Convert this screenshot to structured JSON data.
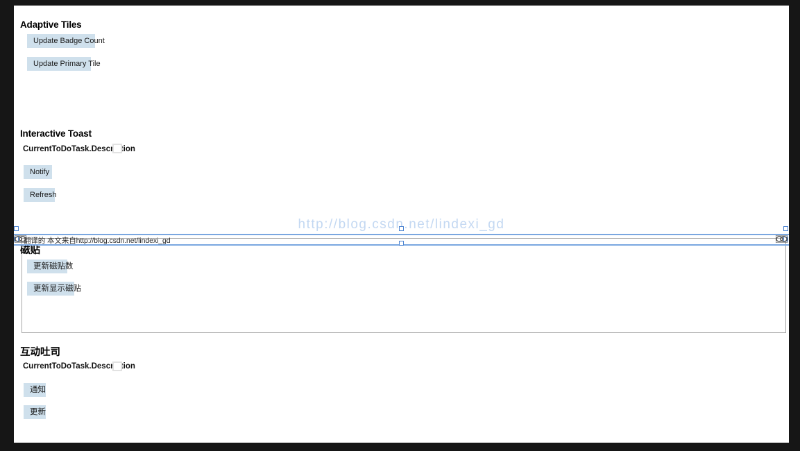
{
  "window": {
    "background": "#161616",
    "page_background": "#ffffff"
  },
  "colors": {
    "button": "#cfe0ec",
    "selection": "#7aa7e0",
    "watermark": "#c3d8f2",
    "box_border": "#a6a6a6"
  },
  "original": {
    "tiles_section": {
      "title": "Adaptive Tiles",
      "buttons": [
        {
          "label": "Update Badge Count"
        },
        {
          "label": "Update Primary Tile"
        }
      ]
    },
    "toast_section": {
      "title": "Interactive Toast",
      "field_label": "CurrentToDoTask.Description",
      "field_value": "",
      "buttons": [
        {
          "label": "Notify"
        },
        {
          "label": "Refresh"
        }
      ]
    }
  },
  "overlay": {
    "translation_note": "翻译的 本文来自http://blog.csdn.net/lindexi_gd",
    "link_icon_left": "link-icon",
    "link_icon_right": "link-icon",
    "watermark": "http://blog.csdn.net/lindexi_gd"
  },
  "translated": {
    "tiles_section": {
      "title": "磁贴",
      "buttons": [
        {
          "label": "更新磁贴数"
        },
        {
          "label": "更新显示磁贴"
        }
      ]
    },
    "toast_section": {
      "title": "互动吐司",
      "field_label": "CurrentToDoTask.Description",
      "field_value": "",
      "buttons": [
        {
          "label": "通知"
        },
        {
          "label": "更新"
        }
      ]
    }
  }
}
